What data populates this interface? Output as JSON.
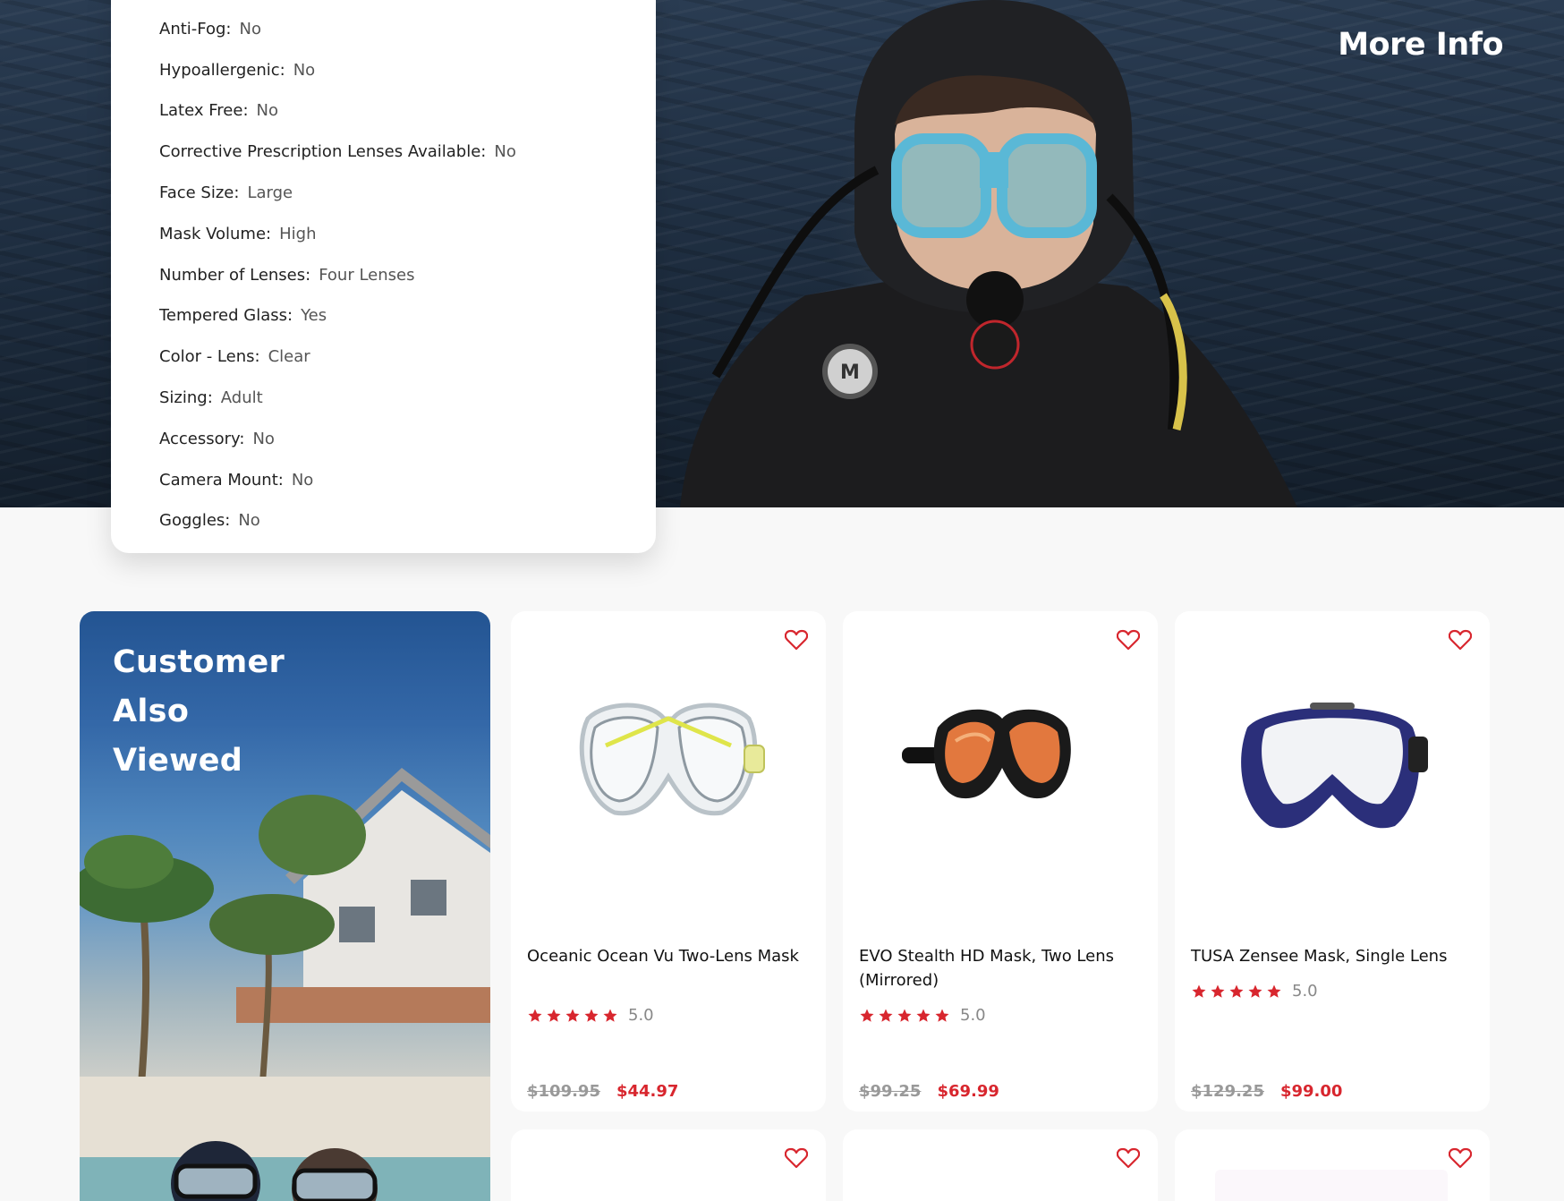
{
  "hero": {
    "title": "More Info"
  },
  "specs": [
    {
      "label": "Anti-Fog:",
      "value": "No"
    },
    {
      "label": "Hypoallergenic:",
      "value": "No"
    },
    {
      "label": "Latex Free:",
      "value": "No"
    },
    {
      "label": "Corrective Prescription Lenses Available:",
      "value": "No"
    },
    {
      "label": "Face Size:",
      "value": "Large"
    },
    {
      "label": "Mask Volume:",
      "value": "High"
    },
    {
      "label": "Number of Lenses:",
      "value": "Four Lenses"
    },
    {
      "label": "Tempered Glass:",
      "value": "Yes"
    },
    {
      "label": "Color - Lens:",
      "value": "Clear"
    },
    {
      "label": "Sizing:",
      "value": "Adult"
    },
    {
      "label": "Accessory:",
      "value": "No"
    },
    {
      "label": "Camera Mount:",
      "value": "No"
    },
    {
      "label": "Goggles:",
      "value": "No"
    }
  ],
  "promo": {
    "line1": "Customer",
    "line2": "Also",
    "line3": "Viewed"
  },
  "products": [
    {
      "name": "Oceanic Ocean Vu Two-Lens Mask",
      "rating": "5.0",
      "stars": 5,
      "old_price": "$109.95",
      "price": "$44.97"
    },
    {
      "name": "EVO Stealth HD Mask, Two Lens (Mirrored)",
      "rating": "5.0",
      "stars": 5,
      "old_price": "$99.25",
      "price": "$69.99"
    },
    {
      "name": "TUSA Zensee Mask, Single Lens",
      "rating": "5.0",
      "stars": 5,
      "old_price": "$129.25",
      "price": "$99.00"
    }
  ],
  "colors": {
    "accent_red": "#d8262e",
    "promo_blue": "#235492",
    "card_bg": "#ffffff",
    "page_bg": "#f8f8f8"
  },
  "icons": {
    "wishlist": "heart-outline-icon",
    "rating": "star-icon"
  }
}
